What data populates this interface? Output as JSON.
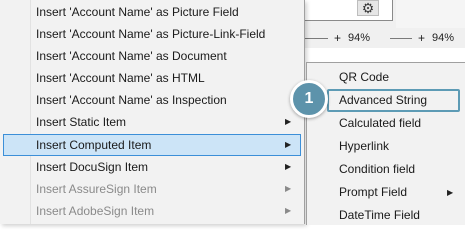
{
  "background": {
    "zoom_levels": [
      "94%",
      "94%"
    ]
  },
  "menu": {
    "items": [
      {
        "label": "Insert 'Account Name' as Picture Field",
        "has_submenu": false,
        "disabled": false
      },
      {
        "label": "Insert 'Account Name' as Picture-Link-Field",
        "has_submenu": false,
        "disabled": false
      },
      {
        "label": "Insert 'Account Name' as Document",
        "has_submenu": false,
        "disabled": false
      },
      {
        "label": "Insert 'Account Name' as HTML",
        "has_submenu": false,
        "disabled": false
      },
      {
        "label": "Insert 'Account Name' as Inspection",
        "has_submenu": false,
        "disabled": false
      },
      {
        "label": "Insert Static Item",
        "has_submenu": true,
        "disabled": false
      },
      {
        "label": "Insert Computed Item",
        "has_submenu": true,
        "disabled": false,
        "highlighted": true
      },
      {
        "label": "Insert DocuSign Item",
        "has_submenu": true,
        "disabled": false
      },
      {
        "label": "Insert AssureSign Item",
        "has_submenu": true,
        "disabled": true
      },
      {
        "label": "Insert AdobeSign Item",
        "has_submenu": true,
        "disabled": true
      }
    ]
  },
  "submenu": {
    "items": [
      {
        "label": "QR Code",
        "has_submenu": false
      },
      {
        "label": "Advanced String",
        "has_submenu": false,
        "outlined": true
      },
      {
        "label": "Calculated field",
        "has_submenu": false
      },
      {
        "label": "Hyperlink",
        "has_submenu": false
      },
      {
        "label": "Condition field",
        "has_submenu": false
      },
      {
        "label": "Prompt Field",
        "has_submenu": true
      },
      {
        "label": "DateTime Field",
        "has_submenu": false
      }
    ]
  },
  "step_badge": {
    "number": "1"
  },
  "colors": {
    "menu_bg": "#f2f2f2",
    "highlight_bg": "#cce4f7",
    "highlight_border": "#3c8fd8",
    "callout": "#5d93ab",
    "disabled_text": "#8a8a8a"
  },
  "icons": {
    "submenu_arrow": "triangle-right-icon",
    "settings": "gear-icon"
  }
}
